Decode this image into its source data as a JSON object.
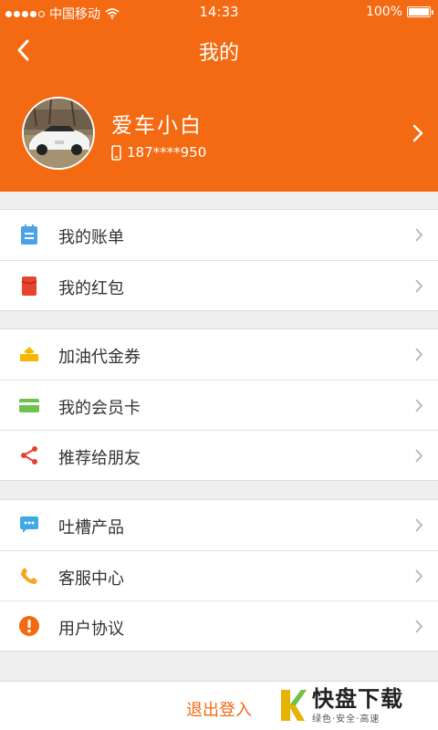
{
  "status_bar": {
    "carrier": "中国移动",
    "time": "14:33",
    "battery": "100%"
  },
  "nav": {
    "title": "我的"
  },
  "profile": {
    "name": "爱车小白",
    "phone": "187****950"
  },
  "menu_groups": [
    [
      {
        "label": "我的账单",
        "icon": "bill-icon",
        "color": "#4aa3e8"
      },
      {
        "label": "我的红包",
        "icon": "red-envelope-icon",
        "color": "#e8432f"
      }
    ],
    [
      {
        "label": "加油代金券",
        "icon": "voucher-icon",
        "color": "#f5b800"
      },
      {
        "label": "我的会员卡",
        "icon": "member-card-icon",
        "color": "#6cc24a"
      },
      {
        "label": "推荐给朋友",
        "icon": "share-icon",
        "color": "#e8432f"
      }
    ],
    [
      {
        "label": "吐槽产品",
        "icon": "feedback-icon",
        "color": "#3fa9e8"
      },
      {
        "label": "客服中心",
        "icon": "phone-icon",
        "color": "#f5a623"
      },
      {
        "label": "用户协议",
        "icon": "info-icon",
        "color": "#f36a13"
      }
    ]
  ],
  "logout": {
    "label": "退出登入"
  },
  "watermark": {
    "main": "快盘下载",
    "sub": "绿色·安全·高速"
  },
  "colors": {
    "accent": "#f36a13",
    "background": "#efefef"
  }
}
